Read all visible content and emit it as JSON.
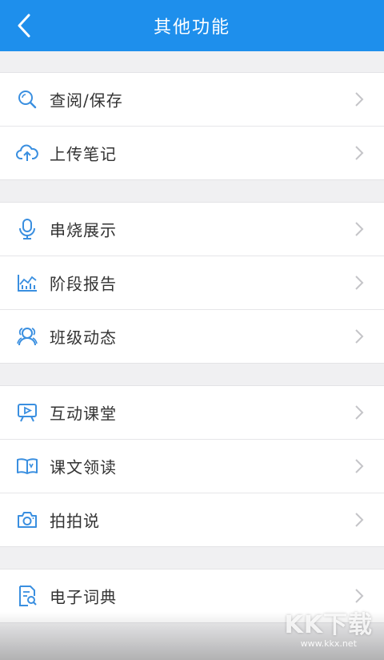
{
  "header": {
    "title": "其他功能",
    "back_icon": "chevron-left-icon"
  },
  "colors": {
    "header_bg": "#1e8fec",
    "icon_blue": "#3a8fe0",
    "chevron": "#c4c4c8"
  },
  "groups": [
    {
      "items": [
        {
          "label": "查阅/保存",
          "icon": "search-icon"
        },
        {
          "label": "上传笔记",
          "icon": "cloud-upload-icon"
        }
      ]
    },
    {
      "items": [
        {
          "label": "串烧展示",
          "icon": "microphone-icon"
        },
        {
          "label": "阶段报告",
          "icon": "chart-icon"
        },
        {
          "label": "班级动态",
          "icon": "group-icon"
        }
      ]
    },
    {
      "items": [
        {
          "label": "互动课堂",
          "icon": "screen-play-icon"
        },
        {
          "label": "课文领读",
          "icon": "book-icon"
        },
        {
          "label": "拍拍说",
          "icon": "camera-icon"
        }
      ]
    },
    {
      "items": [
        {
          "label": "电子词典",
          "icon": "dictionary-icon"
        }
      ]
    }
  ],
  "watermark": {
    "logo": "KK下载",
    "url": "www.kkx.net"
  }
}
